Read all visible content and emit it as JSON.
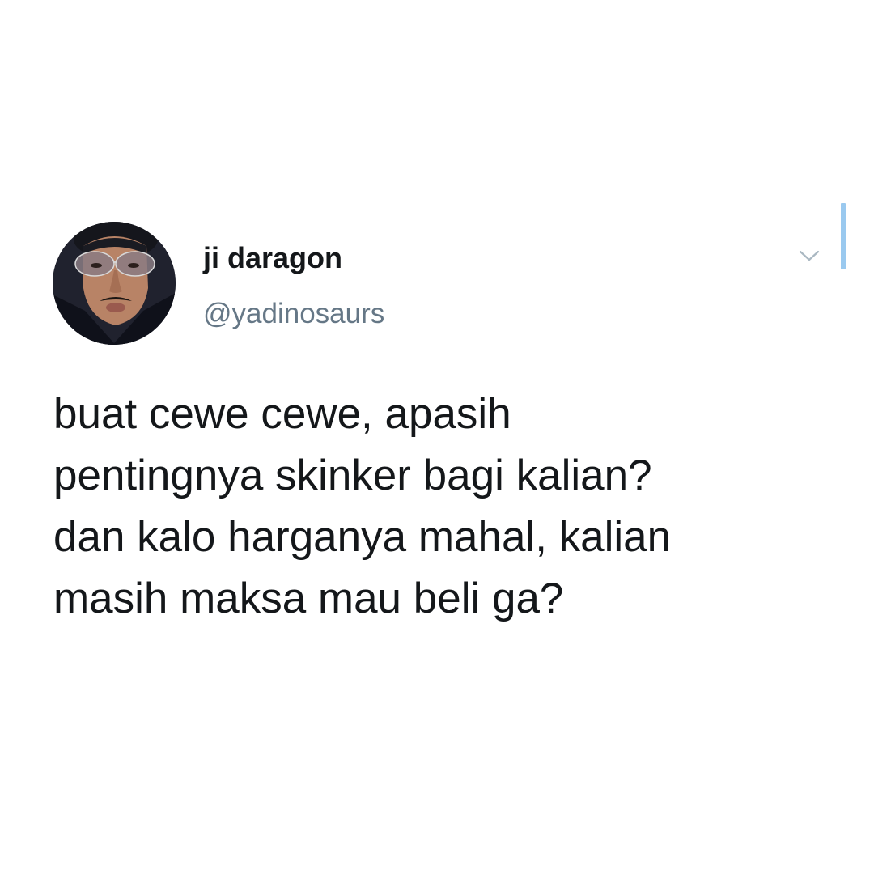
{
  "tweet": {
    "author": {
      "display_name": "ji daragon",
      "handle": "@yadinosaurs",
      "avatar": "profile-photo"
    },
    "menu_icon": "chevron-down-icon",
    "text_lines": [
      "buat cewe cewe, apasih",
      "pentingnya skinker bagi kalian?",
      "dan kalo harganya mahal, kalian",
      "masih maksa mau beli ga?"
    ]
  },
  "colors": {
    "background": "#ffffff",
    "text": "#14171a",
    "handle": "#657786",
    "accent": "#9ac9ef"
  }
}
